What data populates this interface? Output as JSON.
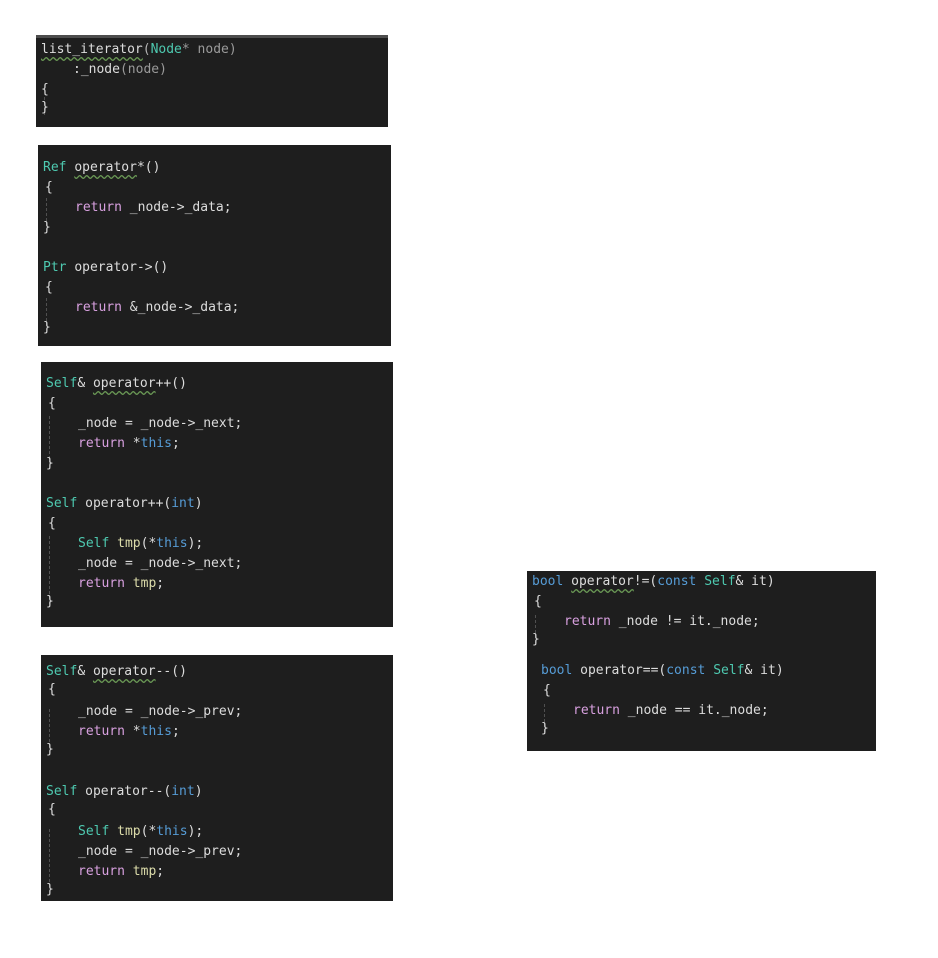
{
  "colors": {
    "background": "#1e1e1e",
    "keyword": "#569cd6",
    "type": "#4ec9b0",
    "flow": "#d8a0df",
    "identifier": "#dcdcdc",
    "squiggle": "#6a9955"
  },
  "ctor": {
    "l1_name": "list_iterator",
    "l1_open": "(",
    "l1_type": "Node",
    "l1_rest": "* node)",
    "l2_init": ":_node",
    "l2_arg": "(node)",
    "open_brace": "{",
    "close_brace": "}"
  },
  "deref": {
    "ret1": "Ref",
    "name1": "operator",
    "sig1_rest": "*()",
    "open1": "{",
    "return1": "return",
    "body1": "_node->_data;",
    "close1": "}",
    "ret2": "Ptr",
    "sig2": "operator->()",
    "open2": "{",
    "return2": "return",
    "body2": "&_node->_data;",
    "close2": "}"
  },
  "inc": {
    "ret1": "Self",
    "amp1": "&",
    "name1": "operator",
    "sig1_rest": "++()",
    "open1": "{",
    "body1_l1": "_node = _node->_next;",
    "return1": "return",
    "star1": "*",
    "this1": "this",
    "semi1": ";",
    "close1": "}",
    "ret2": "Self",
    "sig2_a": "operator++(",
    "int2": "int",
    "sig2_b": ")",
    "open2": "{",
    "tmp_type": "Self",
    "tmp_name": "tmp",
    "tmp_open": "(*",
    "tmp_this": "this",
    "tmp_close": ");",
    "body2_l2": "_node = _node->_next;",
    "return2": "return",
    "ret_val2": "tmp",
    "semi2": ";",
    "close2": "}"
  },
  "dec": {
    "ret1": "Self",
    "amp1": "&",
    "name1": "operator",
    "sig1_rest": "--()",
    "open1": "{",
    "body1_l1": "_node = _node->_prev;",
    "return1": "return",
    "star1": "*",
    "this1": "this",
    "semi1": ";",
    "close1": "}",
    "ret2": "Self",
    "sig2_a": "operator--(",
    "int2": "int",
    "sig2_b": ")",
    "open2": "{",
    "tmp_type": "Self",
    "tmp_name": "tmp",
    "tmp_open": "(*",
    "tmp_this": "this",
    "tmp_close": ");",
    "body2_l2": "_node = _node->_prev;",
    "return2": "return",
    "ret_val2": "tmp",
    "semi2": ";",
    "close2": "}"
  },
  "cmp": {
    "ret1": "bool",
    "name1": "operator",
    "sig1_a": "!=(",
    "const1": "const",
    "self1": "Self",
    "sig1_b": "& it)",
    "open1": "{",
    "return1": "return",
    "body1": "_node != it._node;",
    "close1": "}",
    "ret2": "bool",
    "sig2_a": "operator==(",
    "const2": "const",
    "self2": "Self",
    "sig2_b": "& it)",
    "open2": "{",
    "return2": "return",
    "body2": "_node == it._node;",
    "close2": "}"
  }
}
